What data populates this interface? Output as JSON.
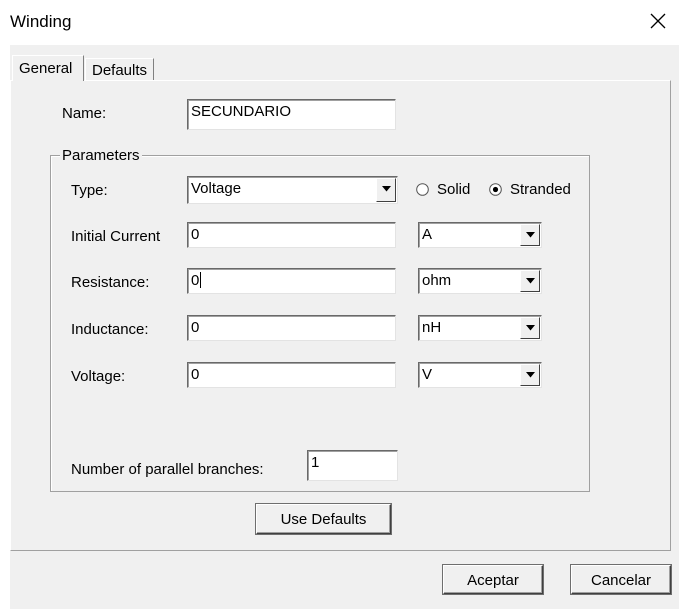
{
  "window": {
    "title": "Winding",
    "close_icon": "close-icon"
  },
  "tabs": [
    {
      "label": "General",
      "selected": true
    },
    {
      "label": "Defaults",
      "selected": false
    }
  ],
  "name": {
    "label": "Name:",
    "value": "SECUNDARIO"
  },
  "parameters": {
    "group_label": "Parameters",
    "type": {
      "label": "Type:",
      "value": "Voltage"
    },
    "conductor": {
      "solid_label": "Solid",
      "stranded_label": "Stranded",
      "selected": "Stranded"
    },
    "initial_current": {
      "label": "Initial Current",
      "value": "0",
      "unit": "A"
    },
    "resistance": {
      "label": "Resistance:",
      "value": "0",
      "unit": "ohm"
    },
    "inductance": {
      "label": "Inductance:",
      "value": "0",
      "unit": "nH"
    },
    "voltage": {
      "label": "Voltage:",
      "value": "0",
      "unit": "V"
    },
    "parallel_branches": {
      "label": "Number of parallel branches:",
      "value": "1"
    }
  },
  "buttons": {
    "use_defaults": "Use Defaults",
    "accept": "Aceptar",
    "cancel": "Cancelar"
  }
}
